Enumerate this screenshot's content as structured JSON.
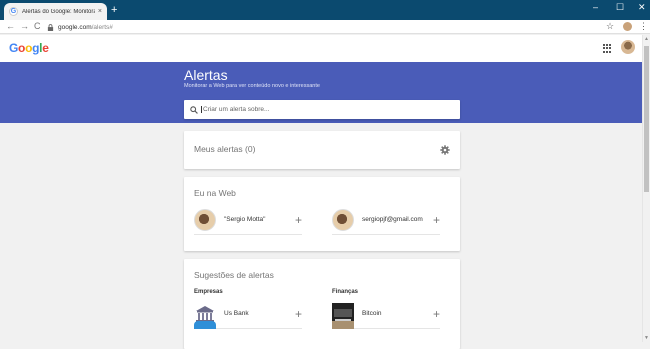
{
  "browser": {
    "tab_title": "Alertas do Google: Monitorar a W",
    "tab_favicon": "G",
    "tab_close": "×",
    "new_tab": "+",
    "url_host": "google.com",
    "url_path": "/alerts#",
    "window_controls": {
      "minimize": "–",
      "maximize": "☐",
      "close": "✕"
    },
    "nav": {
      "back": "←",
      "forward": "→",
      "reload": "C"
    },
    "star": "☆",
    "menu": "⋮"
  },
  "google_bar": {
    "logo_letters": [
      "G",
      "o",
      "o",
      "g",
      "l",
      "e"
    ],
    "logo_colors": [
      "#4285f4",
      "#ea4335",
      "#fbbc05",
      "#4285f4",
      "#34a853",
      "#ea4335"
    ]
  },
  "hero": {
    "title": "Alertas",
    "subtitle": "Monitorar a Web para ver conteúdo novo e interessante",
    "background": "#4a5cb8"
  },
  "search": {
    "placeholder": "Criar um alerta sobre...",
    "icon": "search-icon"
  },
  "my_alerts": {
    "title": "Meus alertas (0)",
    "settings_icon": "gear-icon"
  },
  "me_on_web": {
    "title": "Eu na Web",
    "items": [
      {
        "label": "\"Sergio Motta\"",
        "add": "+"
      },
      {
        "label": "sergiopjf@gmail.com",
        "add": "+"
      }
    ]
  },
  "suggestions": {
    "title": "Sugestões de alertas",
    "columns": [
      {
        "heading": "Empresas",
        "items": [
          {
            "label": "Us Bank",
            "add": "+"
          }
        ]
      },
      {
        "heading": "Finanças",
        "items": [
          {
            "label": "Bitcoin",
            "add": "+"
          }
        ]
      }
    ]
  },
  "scrollbar": {
    "up": "▲",
    "down": "▼"
  }
}
